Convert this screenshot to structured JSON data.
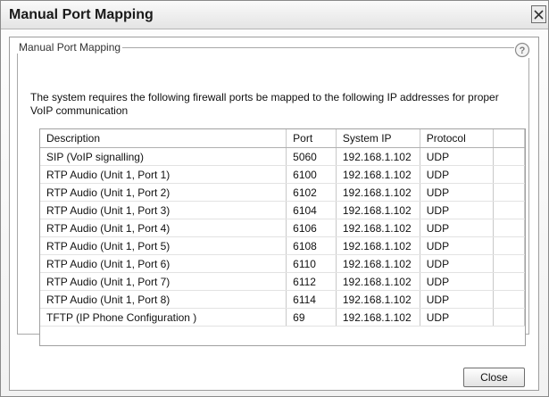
{
  "window": {
    "title": "Manual Port Mapping",
    "close_icon": "close-x-icon"
  },
  "group": {
    "legend": "Manual Port Mapping",
    "help_icon": "question-mark-icon"
  },
  "description": "The system requires the following firewall ports be mapped to the following IP addresses for proper VoIP communication",
  "table": {
    "columns": [
      "Description",
      "Port",
      "System IP",
      "Protocol"
    ],
    "rows": [
      [
        "SIP (VoIP signalling)",
        "5060",
        "192.168.1.102",
        "UDP"
      ],
      [
        "RTP Audio (Unit 1, Port 1)",
        "6100",
        "192.168.1.102",
        "UDP"
      ],
      [
        "RTP Audio (Unit 1, Port 2)",
        "6102",
        "192.168.1.102",
        "UDP"
      ],
      [
        "RTP Audio (Unit 1, Port 3)",
        "6104",
        "192.168.1.102",
        "UDP"
      ],
      [
        "RTP Audio (Unit 1, Port 4)",
        "6106",
        "192.168.1.102",
        "UDP"
      ],
      [
        "RTP Audio (Unit 1, Port 5)",
        "6108",
        "192.168.1.102",
        "UDP"
      ],
      [
        "RTP Audio (Unit 1, Port 6)",
        "6110",
        "192.168.1.102",
        "UDP"
      ],
      [
        "RTP Audio (Unit 1, Port 7)",
        "6112",
        "192.168.1.102",
        "UDP"
      ],
      [
        "RTP Audio (Unit 1, Port 8)",
        "6114",
        "192.168.1.102",
        "UDP"
      ],
      [
        "TFTP (IP Phone Configuration )",
        "69",
        "192.168.1.102",
        "UDP"
      ]
    ]
  },
  "buttons": {
    "close": "Close"
  }
}
